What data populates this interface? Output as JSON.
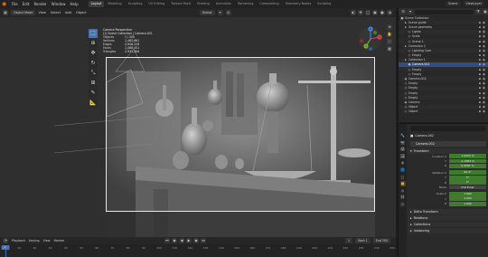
{
  "app": {
    "menu": [
      "File",
      "Edit",
      "Render",
      "Window",
      "Help"
    ],
    "workspaces": [
      "Layout",
      "Modeling",
      "Sculpting",
      "UV Editing",
      "Texture Paint",
      "Shading",
      "Animation",
      "Rendering",
      "Compositing",
      "Geometry Nodes",
      "Scripting"
    ],
    "active_workspace": "Layout",
    "scene_name": "Scene",
    "view_layer": "ViewLayer"
  },
  "viewport": {
    "mode": "Object Mode",
    "menus": [
      "View",
      "Select",
      "Add",
      "Object"
    ],
    "orientation": "Global",
    "camera_info": {
      "title": "Camera Perspective",
      "subtitle": "(1) Scene Collection | Camera.001",
      "rows": [
        {
          "k": "Objects",
          "v": "1 / 200"
        },
        {
          "k": "Vertices",
          "v": "1,465,661"
        },
        {
          "k": "Edges",
          "v": "2,928,226"
        },
        {
          "k": "Faces",
          "v": "1,468,451"
        },
        {
          "k": "Triangles",
          "v": "2,931,006"
        }
      ]
    },
    "gizmo_labels": {
      "x": "X",
      "y": "Y",
      "z": "Z"
    }
  },
  "timeline": {
    "menus": [
      "Playback",
      "Keying",
      "View",
      "Marker"
    ],
    "ticks": [
      "0",
      "10",
      "20",
      "30",
      "40",
      "50",
      "60",
      "70",
      "80",
      "90",
      "100",
      "110",
      "120",
      "130",
      "140",
      "150",
      "160",
      "170",
      "180",
      "190",
      "200",
      "210",
      "220",
      "230",
      "240",
      "250"
    ],
    "current_frame": "1",
    "start_label": "Start",
    "start": "1",
    "end_label": "End",
    "end": "250"
  },
  "outliner": {
    "rows": [
      {
        "label": "Scene Collection",
        "depth": 0,
        "icon": "▣",
        "selected": false
      },
      {
        "label": "Scene guide",
        "depth": 1,
        "icon": "▸",
        "selected": false
      },
      {
        "label": "Scene geometry",
        "depth": 1,
        "icon": "▸",
        "selected": false
      },
      {
        "label": "Lights",
        "depth": 2,
        "icon": "◇",
        "selected": false
      },
      {
        "label": "Scale",
        "depth": 2,
        "icon": "◇",
        "selected": false
      },
      {
        "label": "Scene 1",
        "depth": 2,
        "icon": "◇",
        "selected": false
      },
      {
        "label": "Collection 2",
        "depth": 1,
        "icon": "▸",
        "selected": false
      },
      {
        "label": "Lighting Cam",
        "depth": 2,
        "icon": "◇",
        "selected": false
      },
      {
        "label": "Empty",
        "depth": 2,
        "icon": "◇",
        "selected": false
      },
      {
        "label": "Collection 1",
        "depth": 1,
        "icon": "▸",
        "selected": false
      },
      {
        "label": "Camera.001",
        "depth": 2,
        "icon": "◈",
        "selected": true
      },
      {
        "label": "Empty",
        "depth": 2,
        "icon": "◇",
        "selected": false
      },
      {
        "label": "Empty",
        "depth": 2,
        "icon": "◇",
        "selected": false
      },
      {
        "label": "Camera.002",
        "depth": 1,
        "icon": "◈",
        "selected": false
      },
      {
        "label": "Empty",
        "depth": 1,
        "icon": "◇",
        "selected": false
      },
      {
        "label": "Empty",
        "depth": 1,
        "icon": "◇",
        "selected": false
      },
      {
        "label": "Empty",
        "depth": 1,
        "icon": "◇",
        "selected": false
      },
      {
        "label": "Empty",
        "depth": 1,
        "icon": "◇",
        "selected": false
      },
      {
        "label": "Camera",
        "depth": 1,
        "icon": "◈",
        "selected": false
      },
      {
        "label": "Object",
        "depth": 1,
        "icon": "◇",
        "selected": false
      },
      {
        "label": "Object",
        "depth": 1,
        "icon": "◇",
        "selected": false
      }
    ]
  },
  "properties": {
    "search_placeholder": "",
    "object_label": "Camera.002",
    "object_name": "Camera.002",
    "transform_title": "Transform",
    "location_label": "Location X",
    "location": [
      "1.0253 m",
      "-1.2953 m",
      "0.4581 m"
    ],
    "y_label": "Y",
    "z_label": "Z",
    "rotation_label": "Rotation X",
    "rotation": [
      "90.4°",
      "0°",
      "0°"
    ],
    "mode_label": "Mode",
    "mode_value": "XYZ Euler",
    "scale_label": "Scale X",
    "scale": [
      "1.000",
      "1.000",
      "1.000"
    ],
    "delta_title": "Delta Transform",
    "relations_title": "Relations",
    "collections_title": "Collections",
    "instancing_title": "Instancing"
  }
}
